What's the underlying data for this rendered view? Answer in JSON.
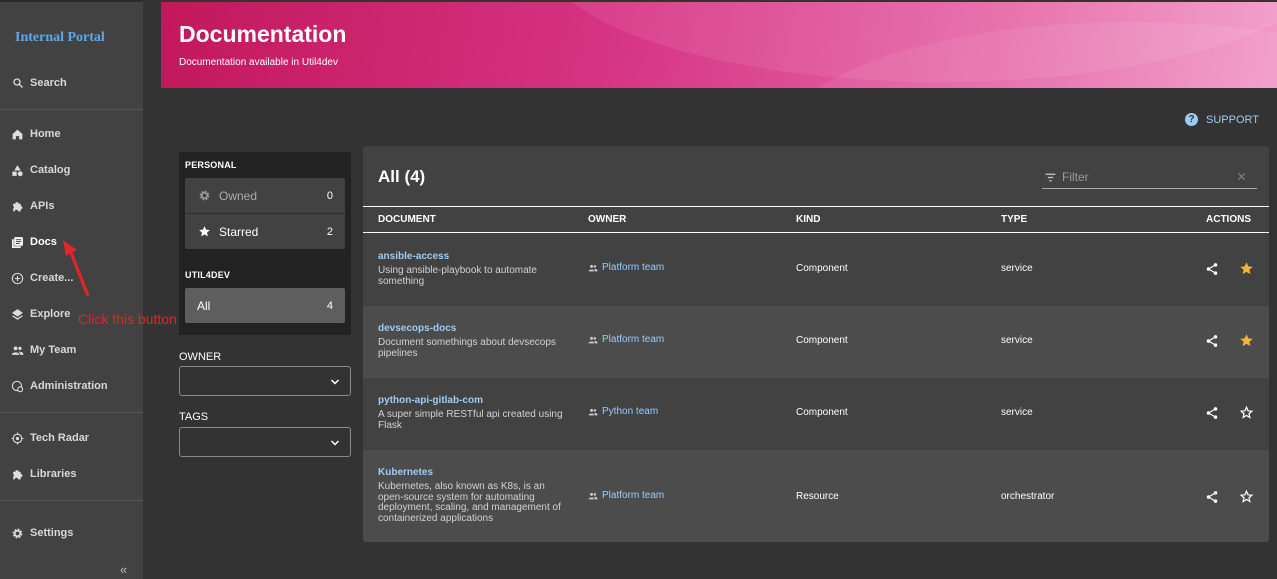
{
  "sidebar": {
    "logo": "Internal Portal",
    "search": "Search",
    "items": [
      {
        "label": "Home",
        "icon": "home-icon"
      },
      {
        "label": "Catalog",
        "icon": "category-icon"
      },
      {
        "label": "APIs",
        "icon": "extension-icon"
      },
      {
        "label": "Docs",
        "icon": "library-books-icon"
      },
      {
        "label": "Create...",
        "icon": "add-circle-icon"
      },
      {
        "label": "Explore",
        "icon": "layers-icon"
      },
      {
        "label": "My Team",
        "icon": "group-icon"
      },
      {
        "label": "Administration",
        "icon": "admin-icon"
      },
      {
        "label": "Tech Radar",
        "icon": "radar-icon"
      },
      {
        "label": "Libraries",
        "icon": "extension-icon"
      },
      {
        "label": "Settings",
        "icon": "gear-icon"
      }
    ],
    "collapse": "«"
  },
  "annotation": {
    "text": "Click this button",
    "color": "#e0262a"
  },
  "header": {
    "title": "Documentation",
    "subtitle": "Documentation available in Util4dev"
  },
  "support": {
    "label": "SUPPORT"
  },
  "filters": {
    "personal_title": "PERSONAL",
    "owned_label": "Owned",
    "owned_count": "0",
    "starred_label": "Starred",
    "starred_count": "2",
    "org_title": "UTIL4DEV",
    "all_label": "All",
    "all_count": "4",
    "owner_label": "OWNER",
    "tags_label": "TAGS"
  },
  "table": {
    "title": "All (4)",
    "filter_placeholder": "Filter",
    "columns": [
      "DOCUMENT",
      "OWNER",
      "KIND",
      "TYPE",
      "ACTIONS"
    ],
    "rows": [
      {
        "name": "ansible-access",
        "desc": "Using ansible-playbook to automate something",
        "owner": "Platform team",
        "kind": "Component",
        "type": "service",
        "starred": true
      },
      {
        "name": "devsecops-docs",
        "desc": "Document somethings about devsecops pipelines",
        "owner": "Platform team",
        "kind": "Component",
        "type": "service",
        "starred": true
      },
      {
        "name": "python-api-gitlab-com",
        "desc": "A super simple RESTful api created using Flask",
        "owner": "Python team",
        "kind": "Component",
        "type": "service",
        "starred": false
      },
      {
        "name": "Kubernetes",
        "desc": "Kubernetes, also known as K8s, is an open-source system for automating deployment, scaling, and management of containerized applications",
        "owner": "Platform team",
        "kind": "Resource",
        "type": "orchestrator",
        "starred": false
      }
    ]
  },
  "colors": {
    "accent": "#c2185b",
    "link": "#9ecbf5",
    "star": "#f2b53a"
  }
}
